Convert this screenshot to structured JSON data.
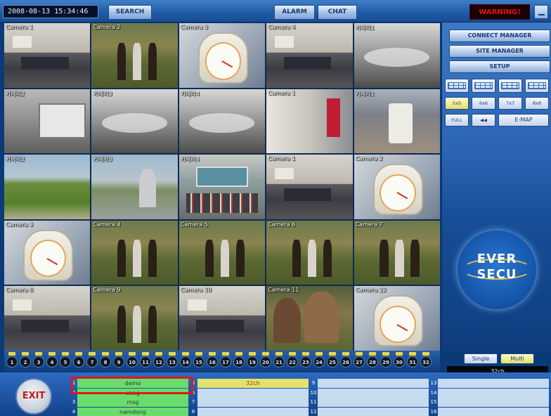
{
  "topbar": {
    "datetime": "2008-08-13   15:34:46",
    "search_label": "SEARCH",
    "alarm_label": "ALARM",
    "chat_label": "CHAT",
    "warning_label": "WARNING!"
  },
  "cameras": [
    {
      "label": "Camera 1",
      "scene": "office"
    },
    {
      "label": "Camera 2",
      "scene": "garden"
    },
    {
      "label": "Camera 3",
      "scene": "clock"
    },
    {
      "label": "Camera 4",
      "scene": "office"
    },
    {
      "label": "카메라1",
      "scene": "mono"
    },
    {
      "label": "카메라2",
      "scene": "truck"
    },
    {
      "label": "카메라3",
      "scene": "mono"
    },
    {
      "label": "카메라4",
      "scene": "mono"
    },
    {
      "label": "Camera 1",
      "scene": "sign"
    },
    {
      "label": "카메라1",
      "scene": "tank"
    },
    {
      "label": "카메라2",
      "scene": "field"
    },
    {
      "label": "카메라3",
      "scene": "field2"
    },
    {
      "label": "카메라4",
      "scene": "panel"
    },
    {
      "label": "Camera 1",
      "scene": "office"
    },
    {
      "label": "Camera 2",
      "scene": "clock"
    },
    {
      "label": "Camera 3",
      "scene": "clock"
    },
    {
      "label": "Camera 4",
      "scene": "garden"
    },
    {
      "label": "Camera 5",
      "scene": "garden"
    },
    {
      "label": "Camera 6",
      "scene": "garden"
    },
    {
      "label": "Camera 7",
      "scene": "garden"
    },
    {
      "label": "Camera 8",
      "scene": "office"
    },
    {
      "label": "Camera 9",
      "scene": "garden"
    },
    {
      "label": "Camera 10",
      "scene": "office"
    },
    {
      "label": "Camera 11",
      "scene": "faces"
    },
    {
      "label": "Camera 12",
      "scene": "clock"
    }
  ],
  "right_panel": {
    "connect_manager": "CONNECT MANAGER",
    "site_manager": "SITE MANAGER",
    "setup": "SETUP",
    "sizes": [
      "5x5",
      "6x6",
      "7x7",
      "8x8"
    ],
    "active_size": "5x5",
    "full_label": "FULL",
    "back_label": "◀◀",
    "emap_label": "E-MAP",
    "logo_line1": "EVER",
    "logo_line2": "SECU"
  },
  "channels": [
    "1",
    "2",
    "3",
    "4",
    "5",
    "6",
    "7",
    "8",
    "9",
    "10",
    "11",
    "12",
    "13",
    "14",
    "15",
    "16",
    "17",
    "18",
    "19",
    "20",
    "21",
    "22",
    "23",
    "24",
    "25",
    "26",
    "27",
    "28",
    "29",
    "30",
    "31",
    "32"
  ],
  "mode": {
    "single": "Single",
    "multi": "Multi",
    "active": "Multi"
  },
  "channel_count": "32ch",
  "exit_label": "EXIT",
  "slots": {
    "col1": [
      {
        "num": "1",
        "text": "demo",
        "style": "green"
      },
      {
        "num": "2",
        "text": "sang",
        "style": "green"
      },
      {
        "num": "3",
        "text": "msg",
        "style": "green"
      },
      {
        "num": "4",
        "text": "namdong",
        "style": "green"
      }
    ],
    "col2": [
      {
        "num": "5",
        "text": "32ch",
        "style": "yellow"
      },
      {
        "num": "6",
        "text": "",
        "style": "light"
      },
      {
        "num": "7",
        "text": "",
        "style": "light"
      },
      {
        "num": "8",
        "text": "",
        "style": "light"
      }
    ],
    "col3": [
      {
        "num": "9",
        "text": "",
        "style": "light"
      },
      {
        "num": "10",
        "text": "",
        "style": "light"
      },
      {
        "num": "11",
        "text": "",
        "style": "light"
      },
      {
        "num": "12",
        "text": "",
        "style": "light"
      }
    ],
    "col4": [
      {
        "num": "13",
        "text": "",
        "style": "light"
      },
      {
        "num": "14",
        "text": "",
        "style": "light"
      },
      {
        "num": "15",
        "text": "",
        "style": "light"
      },
      {
        "num": "16",
        "text": "",
        "style": "light"
      }
    ]
  }
}
